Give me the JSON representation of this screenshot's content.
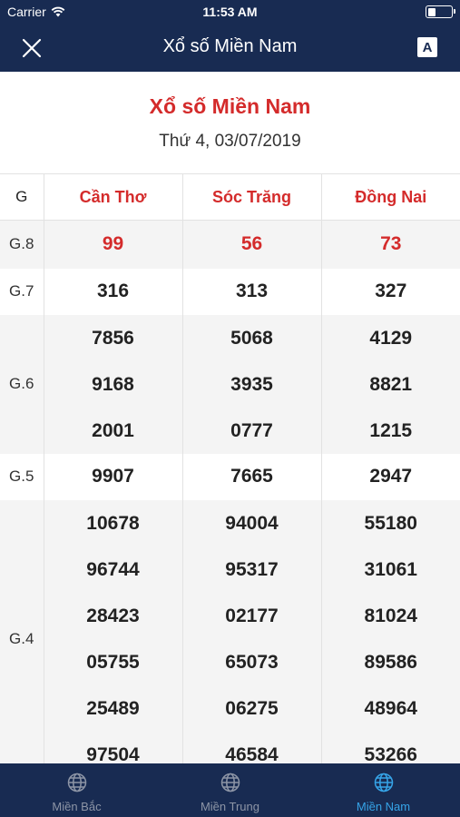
{
  "status_bar": {
    "carrier": "Carrier",
    "time": "11:53 AM"
  },
  "nav": {
    "title": "Xổ số Miền Nam",
    "font_button": "A"
  },
  "heading": {
    "title": "Xổ số Miền Nam",
    "date": "Thứ 4, 03/07/2019"
  },
  "table": {
    "headers": [
      "G",
      "Cần Thơ",
      "Sóc Trăng",
      "Đồng Nai"
    ],
    "rows": {
      "g8": {
        "label": "G.8",
        "values": [
          "99",
          "56",
          "73"
        ]
      },
      "g7": {
        "label": "G.7",
        "values": [
          "316",
          "313",
          "327"
        ]
      },
      "g6": {
        "label": "G.6",
        "values": [
          [
            "7856",
            "9168",
            "2001"
          ],
          [
            "5068",
            "3935",
            "0777"
          ],
          [
            "4129",
            "8821",
            "1215"
          ]
        ]
      },
      "g5": {
        "label": "G.5",
        "values": [
          "9907",
          "7665",
          "2947"
        ]
      },
      "g4": {
        "label": "G.4",
        "values": [
          [
            "10678",
            "96744",
            "28423",
            "05755",
            "25489",
            "97504"
          ],
          [
            "94004",
            "95317",
            "02177",
            "65073",
            "06275",
            "46584"
          ],
          [
            "55180",
            "31061",
            "81024",
            "89586",
            "48964",
            "53266"
          ]
        ]
      }
    }
  },
  "tabs": [
    {
      "label": "Miền Bắc",
      "icon": "globe-icon",
      "active": false
    },
    {
      "label": "Miền Trung",
      "icon": "globe-icon",
      "active": false
    },
    {
      "label": "Miền Nam",
      "icon": "globe-icon",
      "active": true
    }
  ],
  "colors": {
    "navy": "#182b52",
    "accent_red": "#d42b2b",
    "active_tab": "#36a4e8"
  }
}
